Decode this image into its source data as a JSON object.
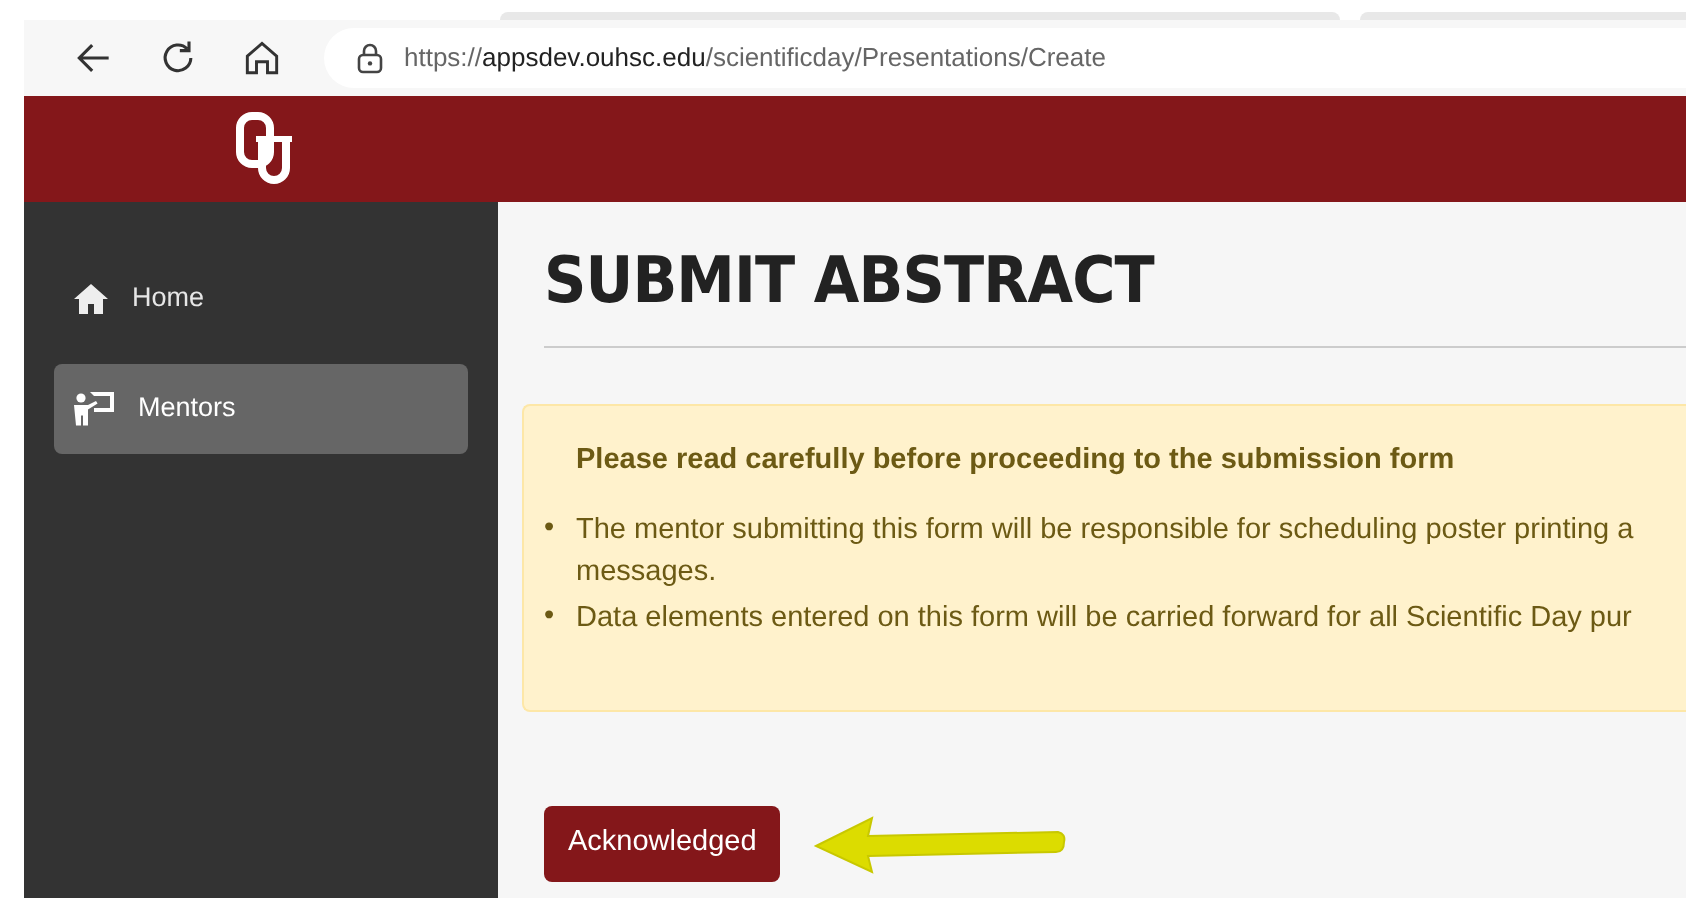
{
  "browser": {
    "url": {
      "scheme": "https://",
      "host": "appsdev.ouhsc.edu",
      "path": "/scientificday/Presentations/Create"
    }
  },
  "sidebar": {
    "items": [
      {
        "label": "Home",
        "selected": false
      },
      {
        "label": "Mentors",
        "selected": true
      }
    ]
  },
  "page": {
    "title": "SUBMIT ABSTRACT",
    "notice": {
      "heading": "Please read carefully before proceeding to the submission form",
      "items": [
        {
          "marker": "•",
          "lines": [
            "The mentor submitting this form will be responsible for scheduling poster printing a",
            "messages."
          ]
        },
        {
          "marker": "•",
          "lines": [
            "Data elements entered on this form will be carried forward for all Scientific Day pur"
          ]
        }
      ]
    },
    "button": "Acknowledged"
  }
}
